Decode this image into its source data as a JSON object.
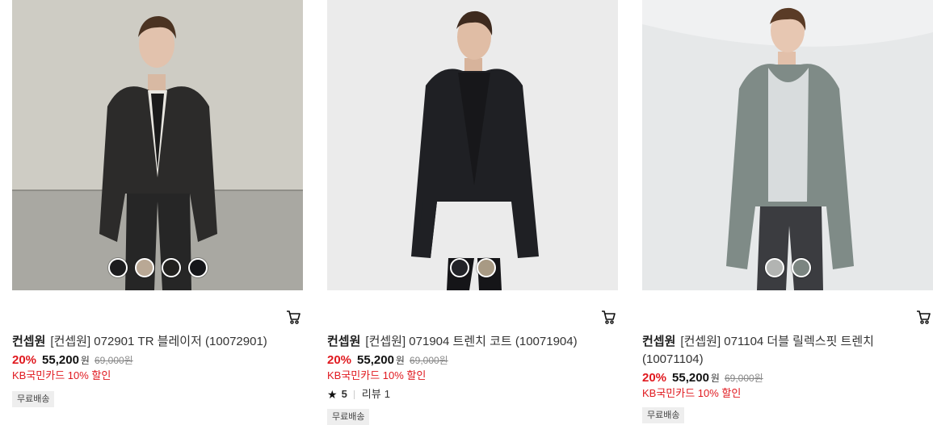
{
  "products": [
    {
      "brand": "컨셉원",
      "name": "[컨셉원] 072901 TR 블레이저 (10072901)",
      "discount_rate": "20%",
      "price": "55,200",
      "currency": "원",
      "original_price": "69,000",
      "original_currency": "원",
      "card_promo": "KB국민카드 10% 할인",
      "badge": "무료배송",
      "swatch_colors": [
        "#1c1c1e",
        "#b9a895",
        "#22211f",
        "#15161a"
      ]
    },
    {
      "brand": "컨셉원",
      "name": "[컨셉원] 071904 트렌치 코트 (10071904)",
      "discount_rate": "20%",
      "price": "55,200",
      "currency": "원",
      "original_price": "69,000",
      "original_currency": "원",
      "card_promo": "KB국민카드 10% 할인",
      "rating": "5",
      "review_label": "리뷰",
      "review_count": "1",
      "badge": "무료배송",
      "swatch_colors": [
        "#222328",
        "#a89a84"
      ]
    },
    {
      "brand": "컨셉원",
      "name": "[컨셉원] 071104 더블 릴렉스핏 트렌치 (10071104)",
      "discount_rate": "20%",
      "price": "55,200",
      "currency": "원",
      "original_price": "69,000",
      "original_currency": "원",
      "card_promo": "KB국민카드 10% 할인",
      "badge": "무료배송",
      "swatch_colors": [
        "#b2b4b2",
        "#7b8581"
      ]
    }
  ],
  "colors": {
    "accent_red": "#e0191f"
  }
}
